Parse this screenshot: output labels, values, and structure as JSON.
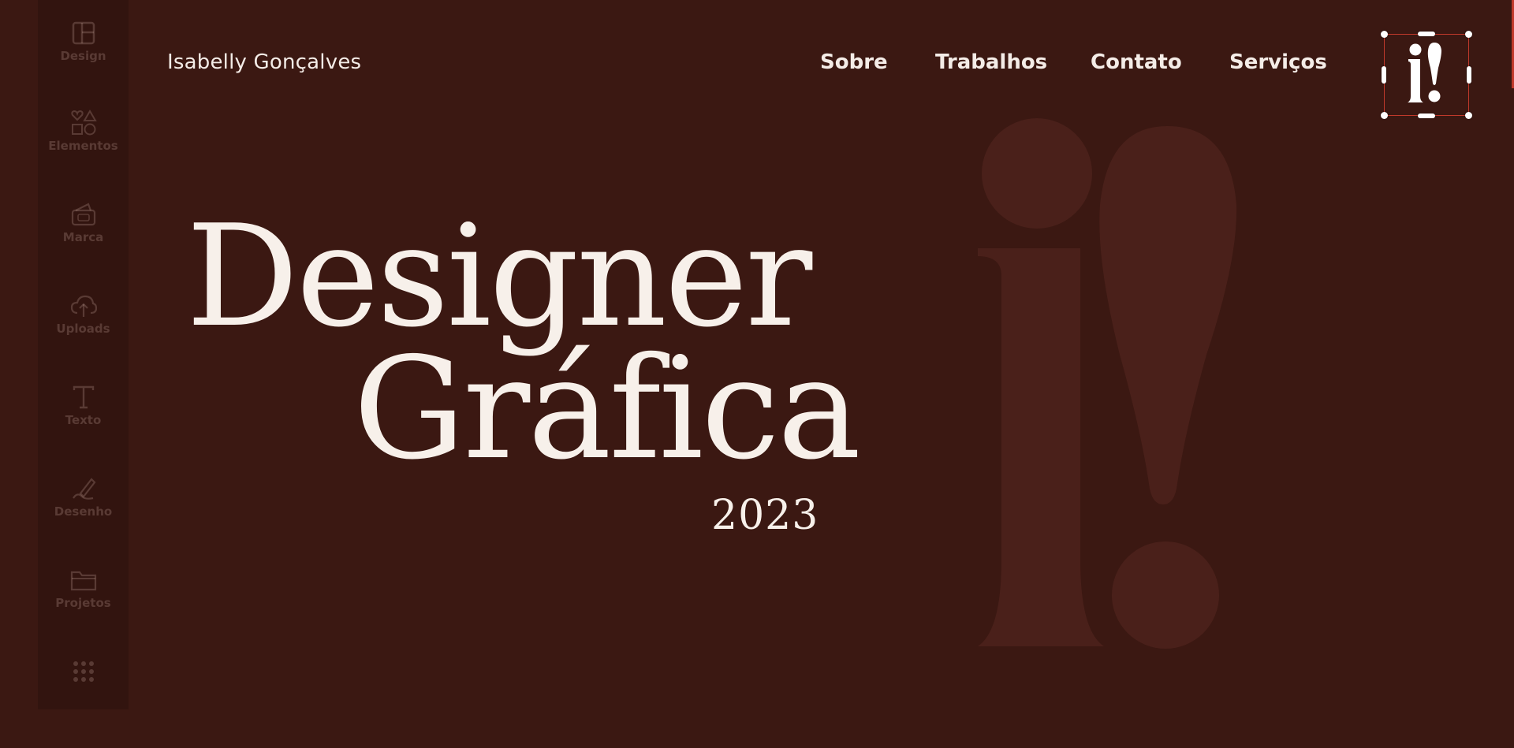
{
  "header": {
    "brand_name": "Isabelly Gonçalves",
    "nav": [
      "Sobre",
      "Trabalhos",
      "Contato",
      "Serviços"
    ],
    "logo_text": "i!"
  },
  "sidebar": {
    "items": [
      {
        "label": "Design",
        "icon": "layout-icon"
      },
      {
        "label": "Elementos",
        "icon": "shapes-icon"
      },
      {
        "label": "Marca",
        "icon": "brand-kit-icon"
      },
      {
        "label": "Uploads",
        "icon": "cloud-upload-icon"
      },
      {
        "label": "Texto",
        "icon": "text-icon"
      },
      {
        "label": "Desenho",
        "icon": "pen-icon"
      },
      {
        "label": "Projetos",
        "icon": "folder-icon"
      },
      {
        "label": "",
        "icon": "apps-grid-icon"
      }
    ]
  },
  "hero": {
    "line1": "Designer",
    "line2": "Gráfica",
    "year": "2023"
  },
  "background_mark": "i!",
  "colors": {
    "background": "#3b1812",
    "text": "#f4ece7",
    "background_mark": "#4a201a",
    "selection": "#c0392b"
  }
}
